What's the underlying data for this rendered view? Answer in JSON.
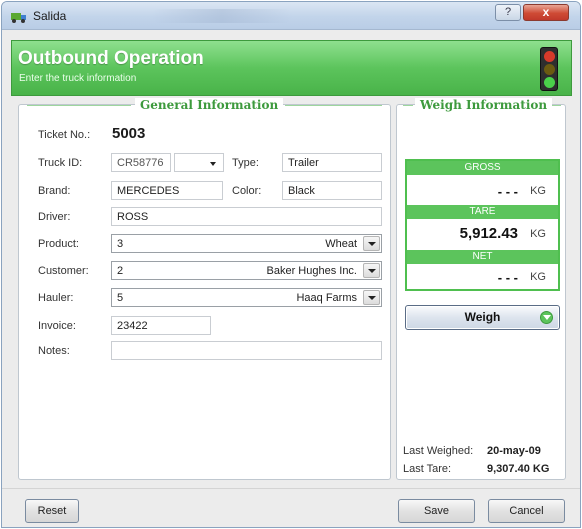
{
  "window": {
    "title": "Salida",
    "help_label": "?",
    "close_label": "x"
  },
  "header": {
    "title": "Outbound Operation",
    "subtitle": "Enter the truck information"
  },
  "general": {
    "legend": "General Information",
    "ticket_label": "Ticket No.:",
    "ticket_value": "5003",
    "truck_id_label": "Truck ID:",
    "truck_id_value": "CR58776",
    "type_label": "Type:",
    "type_value": "Trailer",
    "brand_label": "Brand:",
    "brand_value": "MERCEDES",
    "color_label": "Color:",
    "color_value": "Black",
    "driver_label": "Driver:",
    "driver_value": "ROSS",
    "product_label": "Product:",
    "product_id": "3",
    "product_name": "Wheat",
    "customer_label": "Customer:",
    "customer_id": "2",
    "customer_name": "Baker Hughes Inc.",
    "hauler_label": "Hauler:",
    "hauler_id": "5",
    "hauler_name": "Haaq Farms",
    "invoice_label": "Invoice:",
    "invoice_value": "23422",
    "notes_label": "Notes:",
    "notes_value": ""
  },
  "weigh": {
    "legend": "Weigh Information",
    "gross_label": "GROSS",
    "gross_value": "- - -",
    "gross_unit": "KG",
    "tare_label": "TARE",
    "tare_value": "5,912.43",
    "tare_unit": "KG",
    "net_label": "NET",
    "net_value": "- - -",
    "net_unit": "KG",
    "weigh_button": "Weigh",
    "last_weighed_label": "Last Weighed:",
    "last_weighed_value": "20-may-09",
    "last_tare_label": "Last Tare:",
    "last_tare_value": "9,307.40 KG"
  },
  "footer": {
    "reset_label": "Reset",
    "save_label": "Save",
    "cancel_label": "Cancel"
  },
  "colors": {
    "accent_green": "#5cc45c",
    "title_bar": "#c2d4ea",
    "close_red": "#cf4b35"
  },
  "icons": {
    "app": "salida-app-icon",
    "header": "traffic-light-icon",
    "weigh": "arrow-down-circle-icon"
  }
}
